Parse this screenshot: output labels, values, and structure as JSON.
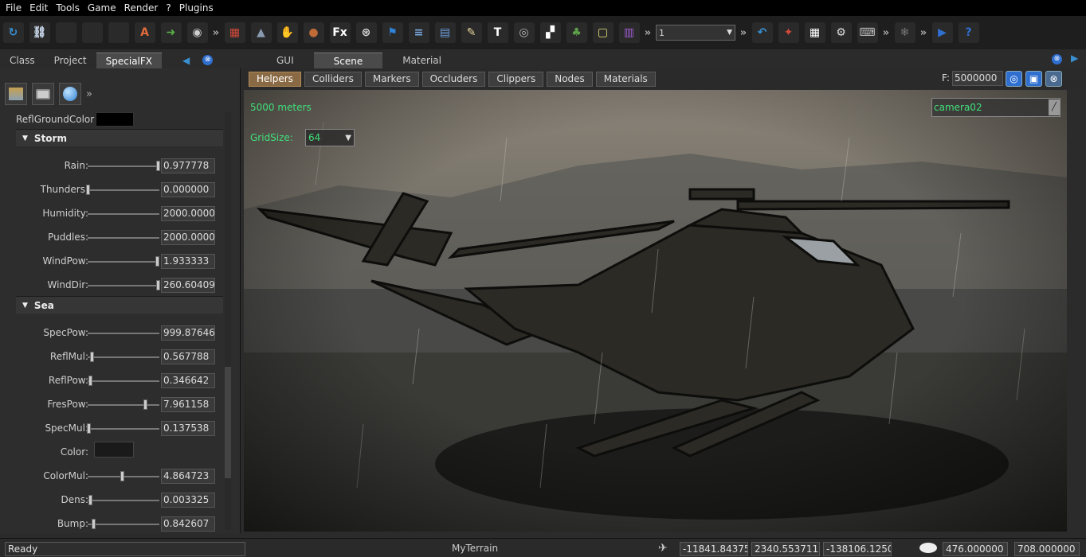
{
  "menu": [
    "File",
    "Edit",
    "Tools",
    "Game",
    "Render",
    "?",
    "Plugins"
  ],
  "toolbar": {
    "icons": [
      {
        "name": "refresh-icon",
        "glyph": "↻",
        "color": "#3a8fd0"
      },
      {
        "name": "node-graph-icon",
        "glyph": "⛓",
        "color": "#c8d6ea"
      },
      {
        "name": "new-document-icon",
        "glyph": "",
        "color": "#f2f2f2"
      },
      {
        "name": "open-folder-icon",
        "glyph": "",
        "color": "#e8c640"
      },
      {
        "name": "save-icon",
        "glyph": "",
        "color": "#d0d0d0"
      },
      {
        "name": "import-ase-icon",
        "glyph": "A",
        "color": "#e26b3a"
      },
      {
        "name": "export-icon",
        "glyph": "➜",
        "color": "#58b047"
      },
      {
        "name": "disc-icon",
        "glyph": "◉",
        "color": "#cfcfcf"
      },
      {
        "name": "more",
        "glyph": "»",
        "color": ""
      },
      {
        "name": "cube-icon",
        "glyph": "▦",
        "color": "#d24a3a"
      },
      {
        "name": "terrain-icon",
        "glyph": "▲",
        "color": "#8a9bb0"
      },
      {
        "name": "hand-icon",
        "glyph": "✋",
        "color": "#8a8a8a"
      },
      {
        "name": "planet-icon",
        "glyph": "●",
        "color": "#c06a38"
      },
      {
        "name": "fx-icon",
        "glyph": "Fx",
        "color": ""
      },
      {
        "name": "wheel-icon",
        "glyph": "⊛",
        "color": "#d8d8d8"
      },
      {
        "name": "flag-icon",
        "glyph": "⚑",
        "color": "#2f84d8"
      },
      {
        "name": "script-icon",
        "glyph": "≡",
        "color": "#7aa8e0"
      },
      {
        "name": "layout-icon",
        "glyph": "▤",
        "color": "#6c9fe0"
      },
      {
        "name": "notepad-icon",
        "glyph": "✎",
        "color": "#e8d59a"
      },
      {
        "name": "text-icon",
        "glyph": "T",
        "color": ""
      },
      {
        "name": "sound-icon",
        "glyph": "◎",
        "color": "#bbbbbb"
      },
      {
        "name": "checker-icon",
        "glyph": "▞",
        "color": "#ffffff"
      },
      {
        "name": "tree-icon",
        "glyph": "♣",
        "color": "#5ca04a"
      },
      {
        "name": "note-icon",
        "glyph": "▢",
        "color": "#e6e07a"
      },
      {
        "name": "purple-doc-icon",
        "glyph": "▥",
        "color": "#a05cd0"
      }
    ],
    "combo_value": "1",
    "icons2": [
      {
        "name": "undo-icon",
        "glyph": "↶",
        "color": "#3a8fd0"
      },
      {
        "name": "new-terrain-icon",
        "glyph": "✦",
        "color": "#d24a3a"
      },
      {
        "name": "grid-icon",
        "glyph": "▦",
        "color": "#ffffff"
      },
      {
        "name": "gear-icon",
        "glyph": "⚙",
        "color": "#dddddd"
      },
      {
        "name": "keyboard-icon",
        "glyph": "⌨",
        "color": "#bbbbbb"
      }
    ],
    "icons3": [
      {
        "name": "snowflake-icon",
        "glyph": "❄",
        "color": "#777777"
      }
    ],
    "icons4": [
      {
        "name": "play-icon",
        "glyph": "▶",
        "color": "#2f6fd0"
      },
      {
        "name": "help-icon",
        "glyph": "?",
        "color": "#2f6fd0"
      }
    ]
  },
  "left_tabs": [
    "Class",
    "Project",
    "SpecialFX"
  ],
  "left_panel": {
    "refl_ground_label": "ReflGroundColor",
    "storm_label": "Storm",
    "storm_rows": [
      {
        "label": "Rain:",
        "value": "0.977778",
        "level": 0.98
      },
      {
        "label": "Thunders:",
        "value": "0.000000",
        "level": 0.0
      },
      {
        "label": "Humidity:",
        "value": "2000.0000",
        "level": null
      },
      {
        "label": "Puddles:",
        "value": "2000.0000",
        "level": null
      },
      {
        "label": "WindPow:",
        "value": "1.933333",
        "level": 0.97
      },
      {
        "label": "WindDir:",
        "value": "260.60409",
        "level": 0.98
      }
    ],
    "sea_label": "Sea",
    "sea_rows": [
      {
        "label": "SpecPow:",
        "value": "999.87646",
        "level": null
      },
      {
        "label": "ReflMul:",
        "value": "0.567788",
        "level": 0.06
      },
      {
        "label": "ReflPow:",
        "value": "0.346642",
        "level": 0.03
      },
      {
        "label": "FresPow:",
        "value": "7.961158",
        "level": 0.8
      },
      {
        "label": "SpecMul:",
        "value": "0.137538",
        "level": 0.01
      },
      {
        "label": "Color:",
        "value": "",
        "level": "swatch"
      },
      {
        "label": "ColorMul:",
        "value": "4.864723",
        "level": 0.48
      },
      {
        "label": "Dens:",
        "value": "0.003325",
        "level": 0.03
      },
      {
        "label": "Bump:",
        "value": "0.842607",
        "level": 0.08
      }
    ]
  },
  "right_tabs": [
    "GUI",
    "Scene",
    "Material"
  ],
  "filters": [
    "Helpers",
    "Colliders",
    "Markers",
    "Occluders",
    "Clippers",
    "Nodes",
    "Materials"
  ],
  "far_label": "F:",
  "far_value": "5000000",
  "viewport": {
    "distance_text": "5000 meters",
    "gridsize_label": "GridSize:",
    "gridsize_value": "64",
    "camera": "camera02"
  },
  "status": {
    "ready": "Ready",
    "scene": "MyTerrain",
    "x": "-11841.84375",
    "y": "2340.553711",
    "z": "-138106.1250",
    "w": "476.000000",
    "h": "708.000000"
  }
}
